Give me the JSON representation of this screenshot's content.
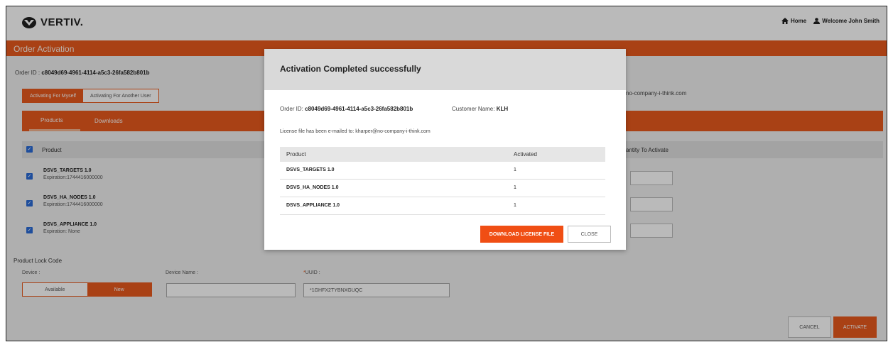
{
  "header": {
    "logo_text": "VERTIV.",
    "home_label": "Home",
    "welcome_label": "Welcome John Smith"
  },
  "page": {
    "title": "Order Activation",
    "order_id_label": "Order ID :",
    "order_id_value": "c8049d69-4961-4114-a5c3-26fa582b801b",
    "activate_myself": "Activating For Myself",
    "activate_other": "Activating For Another User",
    "partial_email": "no-company-i-think.com",
    "tabs": [
      {
        "label": "Products"
      },
      {
        "label": "Downloads"
      }
    ],
    "table_header_product": "Product",
    "table_header_qty": "antity To Activate",
    "products": [
      {
        "name": "DSVS_TARGETS 1.0",
        "expiration": "Expiration:1744416000000"
      },
      {
        "name": "DSVS_HA_NODES 1.0",
        "expiration": "Expiration:1744416000000"
      },
      {
        "name": "DSVS_APPLIANCE 1.0",
        "expiration": "Expiration: None"
      }
    ],
    "lock_code_title": "Product Lock Code",
    "device_label": "Device :",
    "device_name_label": "Device Name :",
    "uuid_label": "UUID :",
    "uuid_required": "*",
    "device_available": "Available",
    "device_new": "New",
    "uuid_value": "*1GHFX2TYBNXGUQC",
    "cancel_label": "CANCEL",
    "activate_label": "ACTIVATE"
  },
  "modal": {
    "title": "Activation Completed successfully",
    "order_id_label": "Order ID:",
    "order_id_value": "c8049d69-4961-4114-a5c3-26fa582b801b",
    "customer_label": "Customer Name:",
    "customer_value": "KLH",
    "email_text": "License file has been e-mailed to:  kharper@no-company-i-think.com",
    "col_product": "Product",
    "col_activated": "Activated",
    "rows": [
      {
        "product": "DSVS_TARGETS 1.0",
        "activated": "1"
      },
      {
        "product": "DSVS_HA_NODES 1.0",
        "activated": "1"
      },
      {
        "product": "DSVS_APPLIANCE 1.0",
        "activated": "1"
      }
    ],
    "download_label": "DOWNLOAD LICENSE FILE",
    "close_label": "CLOSE"
  },
  "colors": {
    "accent": "#e8591d",
    "checkbox": "#2b6cd6"
  }
}
